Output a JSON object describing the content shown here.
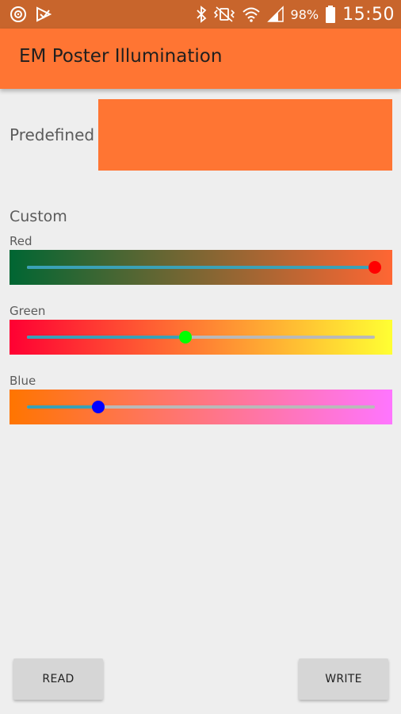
{
  "status_bar": {
    "battery": "98%",
    "time": "15:50",
    "icons": [
      "sync-icon",
      "app-notification-icon",
      "bluetooth-icon",
      "vibrate-icon",
      "wifi-icon",
      "signal-icon",
      "battery-icon"
    ]
  },
  "app_bar": {
    "title": "EM Poster Illumination",
    "color": "#ff7533"
  },
  "predefined": {
    "label": "Predefined",
    "swatch_color": "#ff7533"
  },
  "custom": {
    "heading": "Custom",
    "channels": [
      {
        "label": "Red",
        "value": 1.0,
        "thumb_color": "#ff0000",
        "gradient": [
          "#006633",
          "#ff6633"
        ]
      },
      {
        "label": "Green",
        "value": 0.455,
        "thumb_color": "#00ff00",
        "gradient": [
          "#ff0033",
          "#ffff33"
        ]
      },
      {
        "label": "Blue",
        "value": 0.205,
        "thumb_color": "#0000ff",
        "gradient": [
          "#ff7500",
          "#ff75ff"
        ]
      }
    ]
  },
  "buttons": {
    "read": "READ",
    "write": "WRITE"
  }
}
